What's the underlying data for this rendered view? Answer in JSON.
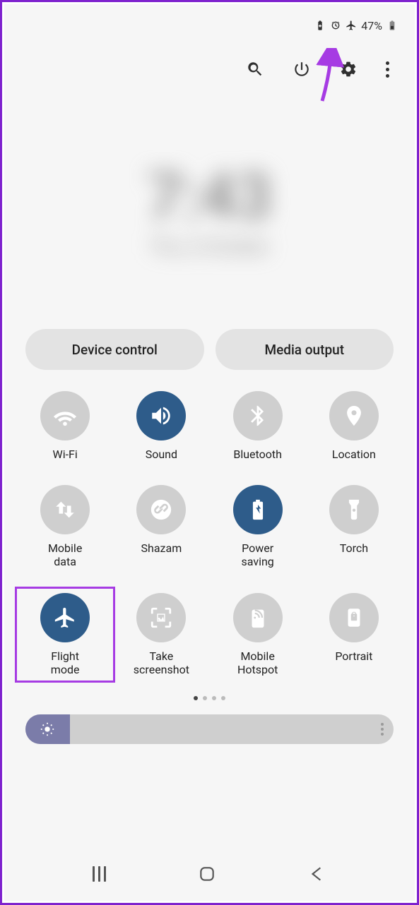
{
  "status": {
    "battery_percent": "47%"
  },
  "clock": {
    "time": "7:43",
    "date": "Thu, 6 October"
  },
  "top_buttons": {
    "device_control": "Device control",
    "media_output": "Media output"
  },
  "tiles": {
    "wifi": "Wi-Fi",
    "sound": "Sound",
    "bluetooth": "Bluetooth",
    "location": "Location",
    "mobile_data": "Mobile\ndata",
    "shazam": "Shazam",
    "power_saving": "Power\nsaving",
    "torch": "Torch",
    "flight_mode": "Flight\nmode",
    "screenshot": "Take\nscreenshot",
    "hotspot": "Mobile\nHotspot",
    "portrait": "Portrait"
  }
}
